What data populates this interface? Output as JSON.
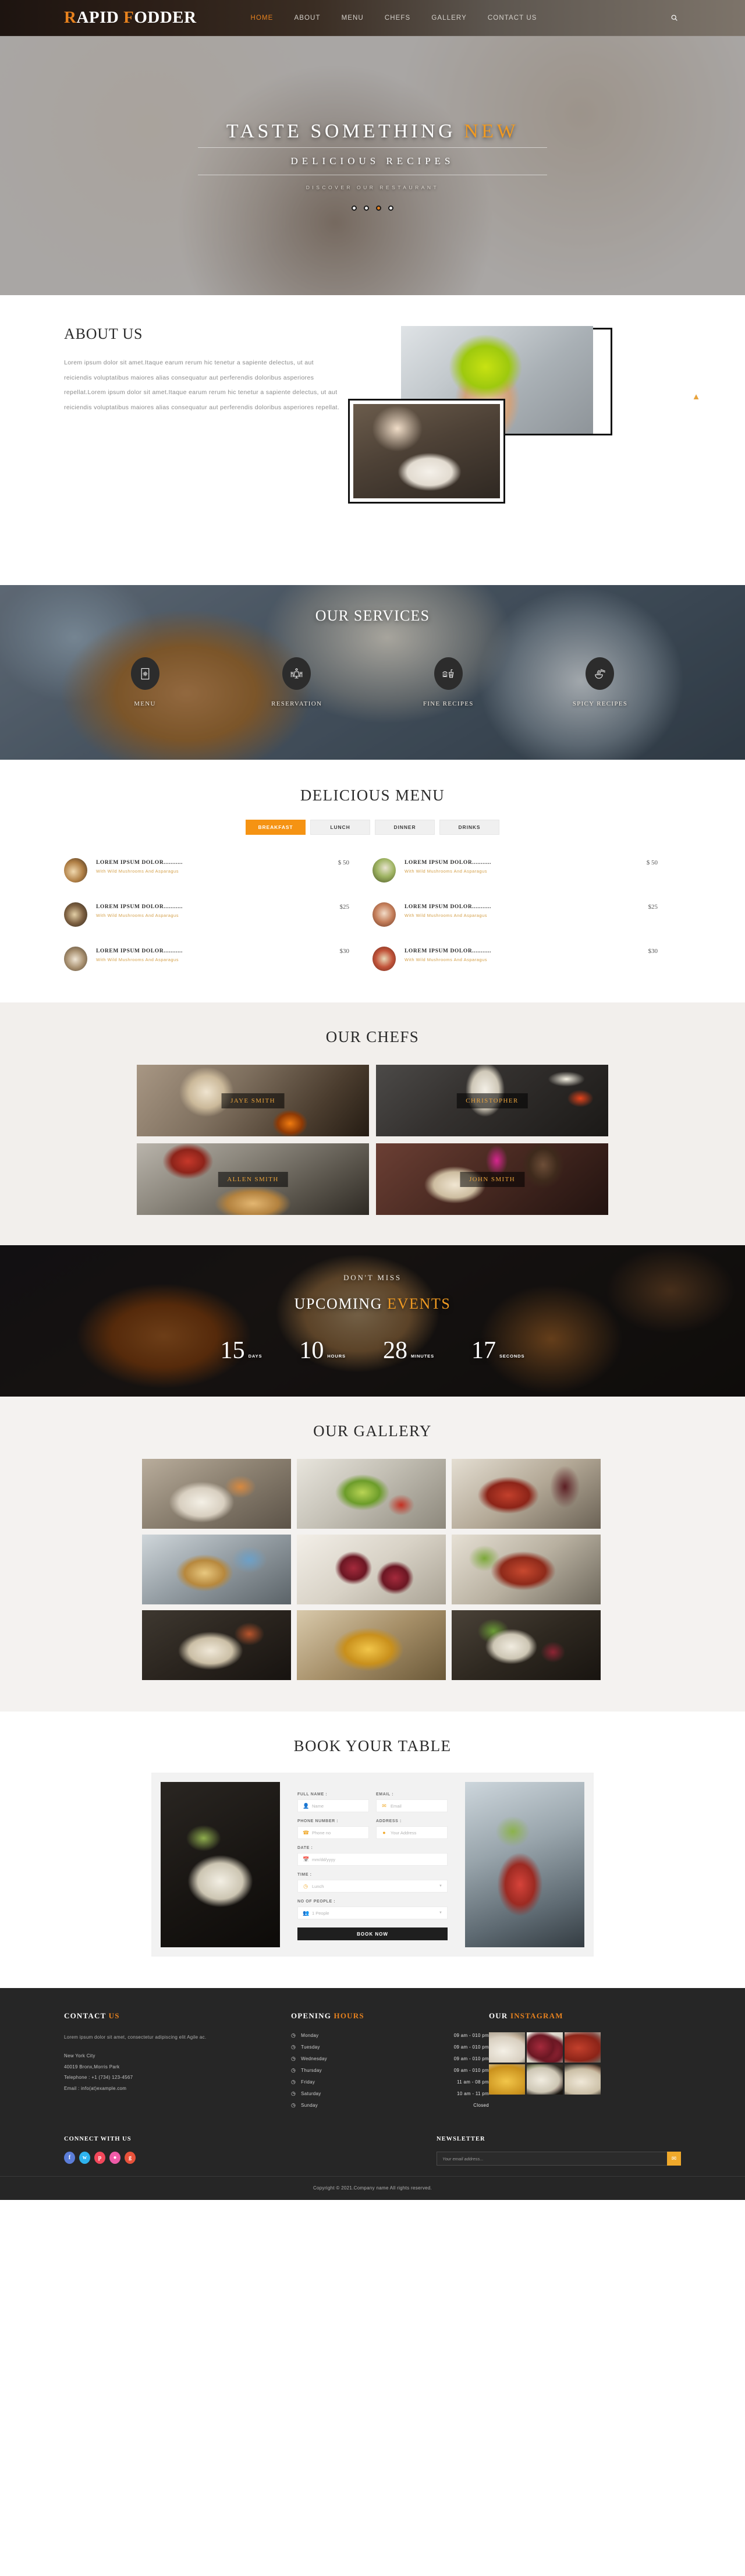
{
  "header": {
    "brand_part1_cap": "R",
    "brand_part1": "APID ",
    "brand_part2_cap": "F",
    "brand_part2": "ODDER",
    "nav": [
      {
        "label": "HOME",
        "active": true
      },
      {
        "label": "ABOUT",
        "active": false
      },
      {
        "label": "MENU",
        "active": false
      },
      {
        "label": "CHEFS",
        "active": false
      },
      {
        "label": "GALLERY",
        "active": false
      },
      {
        "label": "CONTACT US",
        "active": false
      }
    ],
    "search_icon": "search-icon"
  },
  "hero": {
    "title_main": "TASTE SOMETHING ",
    "title_accent": "NEW",
    "subtitle": "DELICIOUS RECIPES",
    "discover": "DISCOVER OUR RESTAURANT",
    "slide_count": 4,
    "active_slide": 3
  },
  "about": {
    "title": "ABOUT US",
    "paragraph": "Lorem ipsum dolor sit amet.Itaque earum rerum hic tenetur a sapiente delectus, ut aut reiciendis voluptatibus maiores alias consequatur aut perferendis doloribus asperiores repellat.Lorem ipsum dolor sit amet.Itaque earum rerum hic tenetur a sapiente delectus, ut aut reiciendis voluptatibus maiores alias consequatur aut perferendis doloribus asperiores repellat."
  },
  "services": {
    "title": "OUR SERVICES",
    "items": [
      {
        "label": "MENU",
        "icon": "menu-card-icon"
      },
      {
        "label": "RESERVATION",
        "icon": "table-reservation-icon"
      },
      {
        "label": "FINE RECIPES",
        "icon": "burger-drink-icon"
      },
      {
        "label": "SPICY RECIPES",
        "icon": "noodle-bowl-icon"
      }
    ]
  },
  "menu": {
    "title": "DELICIOUS MENU",
    "tabs": [
      {
        "label": "BREAKFAST",
        "active": true
      },
      {
        "label": "LUNCH",
        "active": false
      },
      {
        "label": "DINNER",
        "active": false
      },
      {
        "label": "DRINKS",
        "active": false
      }
    ],
    "items": [
      {
        "name": "LOREM IPSUM DOLOR...........",
        "desc": "With Wild Mushrooms And Asparagus",
        "price": "$ 50"
      },
      {
        "name": "LOREM IPSUM DOLOR...........",
        "desc": "With Wild Mushrooms And Asparagus",
        "price": "$ 50"
      },
      {
        "name": "LOREM IPSUM DOLOR...........",
        "desc": "With Wild Mushrooms And Asparagus",
        "price": "$25"
      },
      {
        "name": "LOREM IPSUM DOLOR...........",
        "desc": "With Wild Mushrooms And Asparagus",
        "price": "$25"
      },
      {
        "name": "LOREM IPSUM DOLOR...........",
        "desc": "With Wild Mushrooms And Asparagus",
        "price": "$30"
      },
      {
        "name": "LOREM IPSUM DOLOR...........",
        "desc": "With Wild Mushrooms And Asparagus",
        "price": "$30"
      }
    ]
  },
  "chefs": {
    "title": "OUR CHEFS",
    "items": [
      {
        "name": "JAYE SMITH"
      },
      {
        "name": "CHRISTOPHER"
      },
      {
        "name": "ALLEN SMITH"
      },
      {
        "name": "JOHN SMITH"
      }
    ]
  },
  "events": {
    "dont_miss": "DON'T MISS",
    "title_main": "UPCOMING ",
    "title_accent": "EVENTS",
    "countdown": [
      {
        "value": "15",
        "unit": "DAYS"
      },
      {
        "value": "10",
        "unit": "HOURS"
      },
      {
        "value": "28",
        "unit": "MINUTES"
      },
      {
        "value": "17",
        "unit": "SECONDS"
      }
    ]
  },
  "gallery": {
    "title": "OUR GALLERY",
    "cell_count": 9
  },
  "book": {
    "title": "BOOK YOUR TABLE",
    "fields": [
      {
        "label": "FULL NAME :",
        "placeholder": "Name",
        "icon": "user-icon"
      },
      {
        "label": "EMAIL :",
        "placeholder": "Email",
        "icon": "envelope-icon"
      },
      {
        "label": "PHONE NUMBER :",
        "placeholder": "Phone no",
        "icon": "phone-icon"
      },
      {
        "label": "ADDRESS :",
        "placeholder": "Your Address",
        "icon": "location-pin-icon"
      },
      {
        "label": "DATE :",
        "placeholder": "mm/dd/yyyy",
        "icon": "calendar-icon"
      },
      {
        "label": "TIME :",
        "placeholder": "Lunch",
        "icon": "clock-icon"
      },
      {
        "label": "NO OF PEOPLE :",
        "placeholder": "1 People",
        "icon": "people-icon"
      }
    ],
    "submit_label": "BOOK NOW"
  },
  "footer": {
    "contact": {
      "heading_main": "CONTACT ",
      "heading_accent": "US",
      "paragraph": "Lorem ipsum dolor sit amet, consectetur adipiscing elit Agile ac.",
      "city": "New York City",
      "street": "40019 Bronx,Morris Park",
      "telephone": "Telephone : +1 (734) 123-4567",
      "email": "Email : info(at)example.com"
    },
    "hours": {
      "heading_main": "OPENING ",
      "heading_accent": "HOURS",
      "rows": [
        {
          "day": "Monday",
          "time": "09 am - 010 pm"
        },
        {
          "day": "Tuesday",
          "time": "09 am - 010 pm"
        },
        {
          "day": "Wednesday",
          "time": "09 am - 010 pm"
        },
        {
          "day": "Thursday",
          "time": "09 am - 010 pm"
        },
        {
          "day": "Friday",
          "time": "11 am - 08 pm"
        },
        {
          "day": "Saturday",
          "time": "10 am - 11 pm"
        },
        {
          "day": "Sunday",
          "time": "Closed"
        }
      ]
    },
    "instagram": {
      "heading_main": "OUR ",
      "heading_accent": "INSTAGRAM",
      "cell_count": 6
    },
    "connect": {
      "heading": "CONNECT WITH US",
      "socials": [
        {
          "name": "facebook-icon",
          "glyph": "f",
          "color": "#5b7dd8"
        },
        {
          "name": "twitter-icon",
          "glyph": "t",
          "color": "#2eb3ee"
        },
        {
          "name": "pinterest-icon",
          "glyph": "p",
          "color": "#f2475a"
        },
        {
          "name": "dribbble-icon",
          "glyph": "d",
          "color": "#ef5ba8"
        },
        {
          "name": "google-plus-icon",
          "glyph": "g",
          "color": "#e8513a"
        }
      ]
    },
    "newsletter": {
      "heading": "NEWSLETTER",
      "placeholder": "Your email address...",
      "button_icon": "envelope-icon"
    },
    "copyright": "Copyright © 2021.Company name All rights reserved."
  }
}
